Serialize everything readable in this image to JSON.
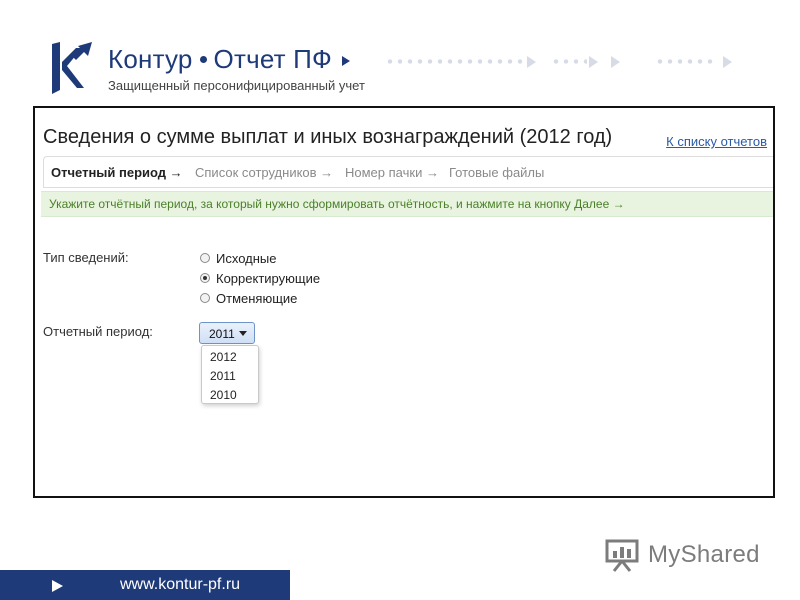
{
  "header": {
    "brand_name": "Контур",
    "brand_product": "Отчет ПФ",
    "tagline": "Защищенный персонифицированный учет"
  },
  "main": {
    "title": "Сведения о сумме выплат и иных вознаграждений (2012 год)",
    "back_link": "К списку отчетов",
    "steps": [
      {
        "label": "Отчетный период →"
      },
      {
        "label": "Список сотрудников →"
      },
      {
        "label": "Номер пачки →"
      },
      {
        "label": "Готовые файлы"
      }
    ],
    "hint": "Укажите отчётный период, за который нужно сформировать отчётность, и нажмите на кнопку Далее →",
    "info_type_label": "Тип сведений:",
    "info_type_options": [
      {
        "label": "Исходные",
        "checked": false
      },
      {
        "label": "Корректирующие",
        "checked": true
      },
      {
        "label": "Отменяющие",
        "checked": false
      }
    ],
    "period_label": "Отчетный период:",
    "period_selected": "2011",
    "period_options": [
      "2012",
      "2011",
      "2010"
    ]
  },
  "footer": {
    "url": "www.kontur-pf.ru",
    "watermark": "MyShared"
  },
  "colors": {
    "brand_blue": "#1f3a78",
    "hint_bg": "#e8f4df",
    "hint_text": "#4b7f2a",
    "link": "#2a5aa8"
  },
  "icons": {
    "logo": "kontur-k-logo-icon",
    "select_caret": "caret-down-icon",
    "footer_arrow": "play-arrow-icon",
    "watermark": "presentation-board-icon"
  }
}
